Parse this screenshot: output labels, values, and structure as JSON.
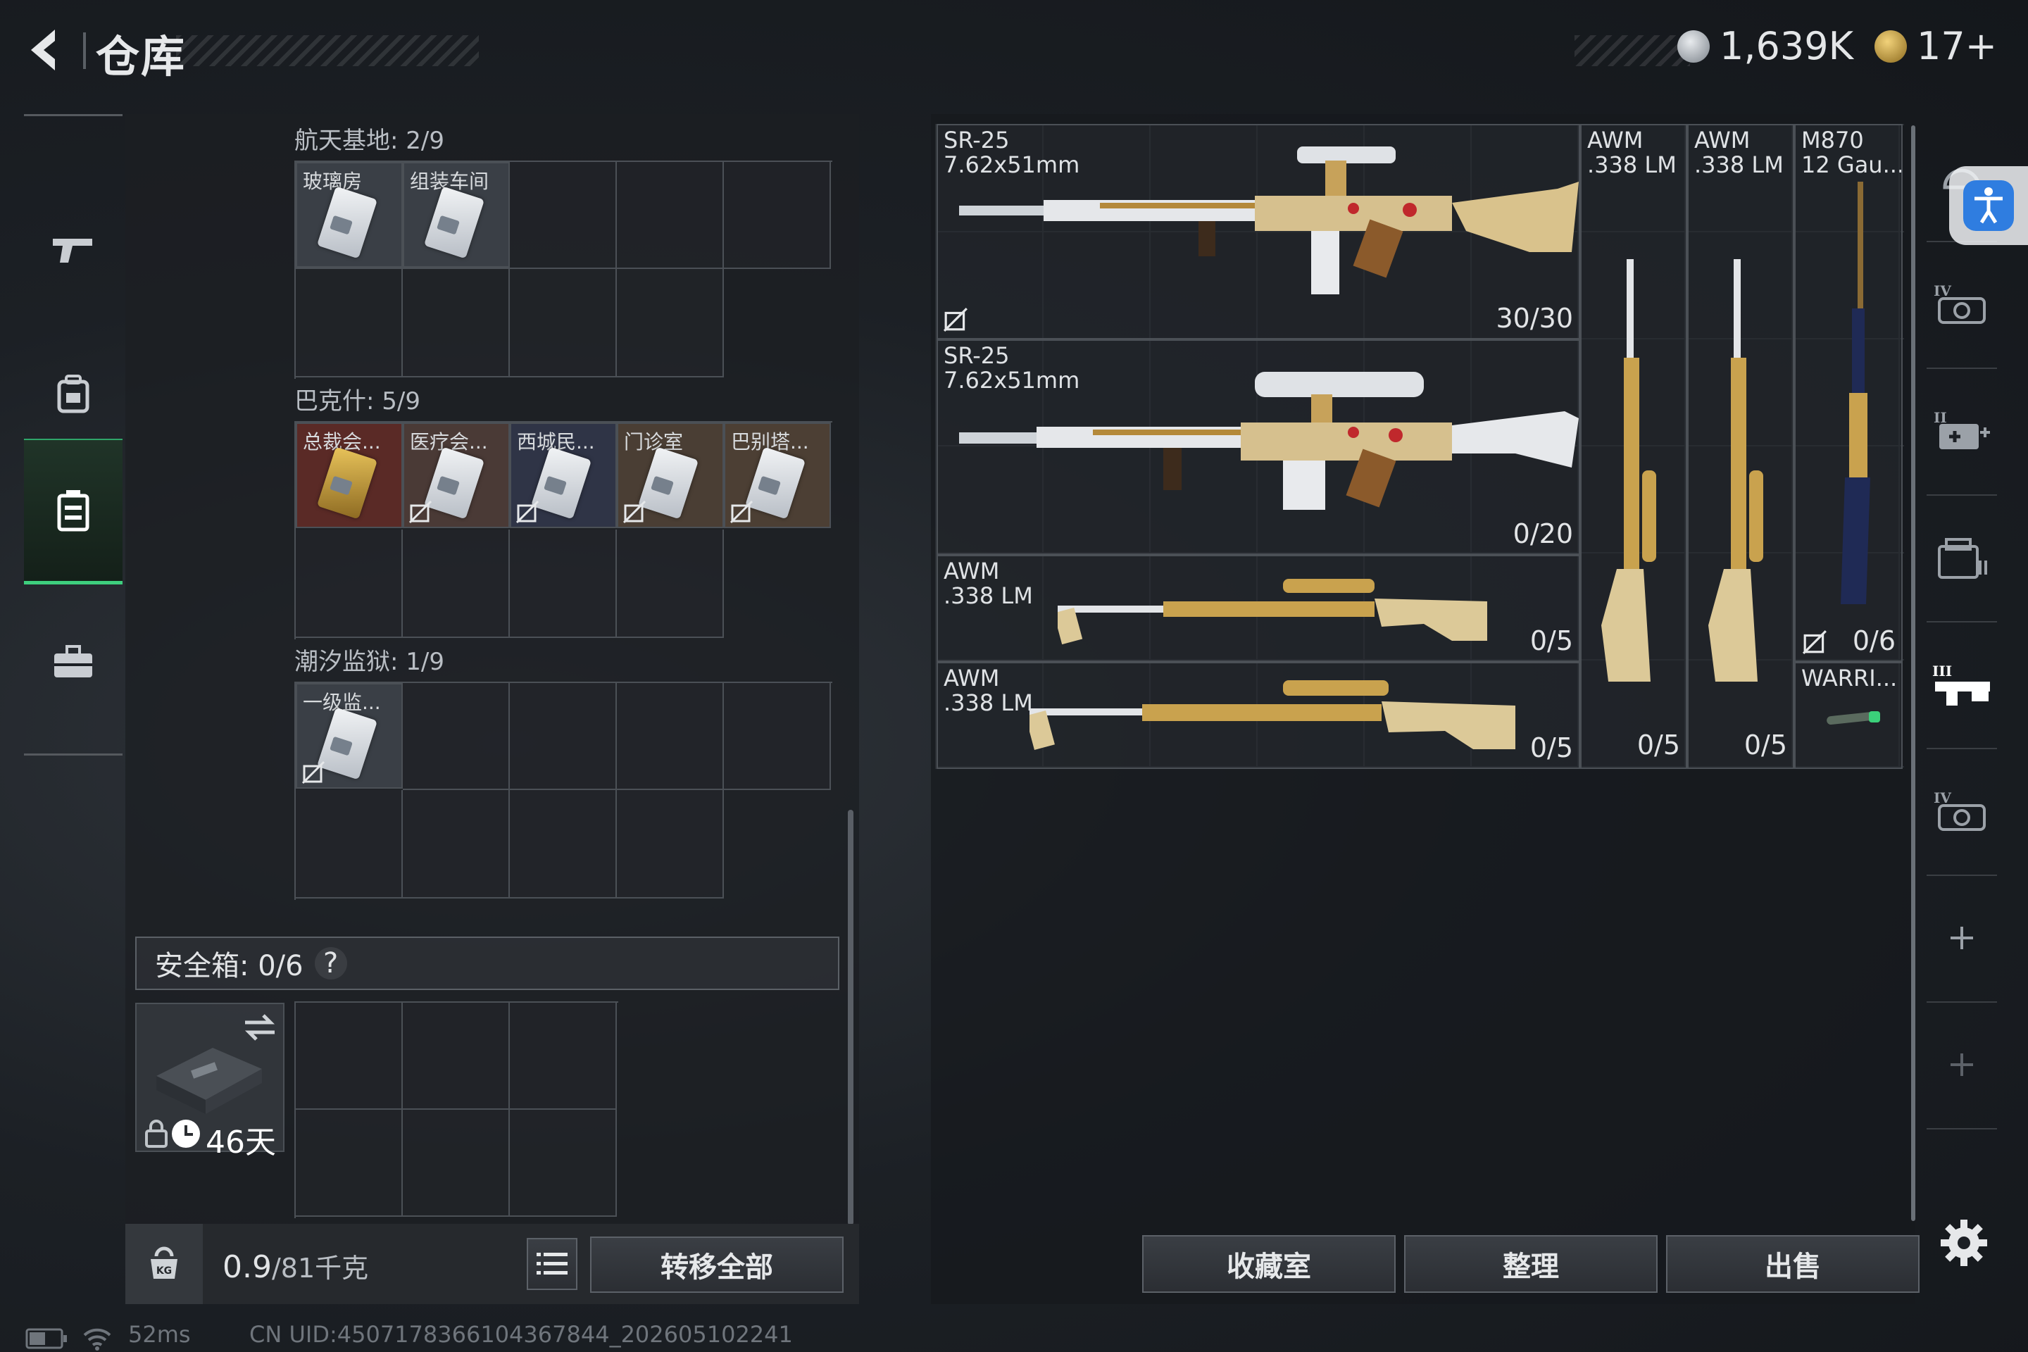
{
  "header": {
    "title": "仓库",
    "currency_1": "1,639K",
    "currency_2": "17+"
  },
  "nav": {
    "items": [
      "weapon-icon",
      "backpack-icon",
      "inventory-icon",
      "toolbox-icon"
    ],
    "active_index": 2
  },
  "containers": [
    {
      "name": "航天基地: 2/9",
      "items": [
        {
          "label": "玻璃房",
          "bound": false
        },
        {
          "label": "组装车间",
          "bound": false
        }
      ]
    },
    {
      "name": "巴克什: 5/9",
      "items": [
        {
          "label": "总裁会...",
          "bound": false,
          "color": "#5a2a26"
        },
        {
          "label": "医疗会...",
          "bound": true,
          "color": "#4a3a36"
        },
        {
          "label": "西城民...",
          "bound": true,
          "color": "#2f3446"
        },
        {
          "label": "门诊室",
          "bound": true,
          "color": "#4a3e34"
        },
        {
          "label": "巴别塔...",
          "bound": true,
          "color": "#4c3f34"
        }
      ]
    },
    {
      "name": "潮汐监狱: 1/9",
      "items": [
        {
          "label": "一级监...",
          "bound": true
        }
      ]
    }
  ],
  "safe_box": {
    "label": "安全箱: 0/6",
    "help": "?",
    "days": "46天"
  },
  "bottom": {
    "weight": "0.9",
    "weight_total": "/81千克",
    "transfer_all": "转移全部"
  },
  "weapons": {
    "sr25_a": {
      "name": "SR-25\n7.62x51mm",
      "count": "30/30"
    },
    "sr25_b": {
      "name": "SR-25\n7.62x51mm",
      "count": "0/20"
    },
    "awm_a": {
      "name": "AWM\n.338 LM",
      "count": "0/5"
    },
    "awm_b": {
      "name": "AWM\n.338 LM",
      "count": "0/5"
    },
    "awm_v1": {
      "name": "AWM\n.338 LM",
      "count": "0/5"
    },
    "awm_v2": {
      "name": "AWM\n.338 LM",
      "count": "0/5"
    },
    "m870": {
      "name": "M870\n12 Gau...",
      "count": "0/6"
    },
    "warrior": {
      "name": "WARRI..."
    }
  },
  "actions": {
    "collection": "收藏室",
    "sort": "整理",
    "sell": "出售"
  },
  "side": {
    "items": [
      "armor-iv-icon",
      "medkit-ii-icon",
      "storage-icon",
      "rifle-iii-icon",
      "armor-iv-icon",
      "add-icon",
      "add-icon"
    ]
  },
  "footer": {
    "ping": "52ms",
    "uid": "CN UID:4507178366104367844_202605102241"
  },
  "colors": {
    "accent_green": "#3ecf7e",
    "accessibility_blue": "#2f7de0"
  }
}
